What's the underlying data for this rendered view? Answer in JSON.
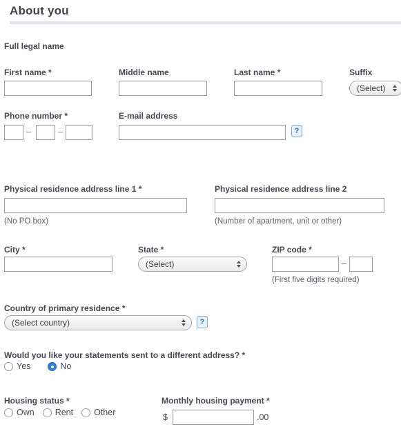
{
  "header": {
    "title": "About you"
  },
  "sections": {
    "full_legal_name": {
      "group_label": "Full legal name",
      "first_name": {
        "label": "First name *",
        "value": "",
        "placeholder": ""
      },
      "middle_name": {
        "label": "Middle name",
        "value": "",
        "placeholder": ""
      },
      "last_name": {
        "label": "Last name *",
        "value": "",
        "placeholder": ""
      },
      "suffix": {
        "label": "Suffix",
        "value": "(Select)"
      }
    },
    "contact": {
      "phone": {
        "label": "Phone number *",
        "part1": "",
        "part2": "",
        "part3": "",
        "separator": "–"
      },
      "email": {
        "label": "E-mail address",
        "value": "",
        "help_glyph": "?"
      }
    },
    "address": {
      "line1": {
        "label": "Physical residence address line 1 *",
        "value": "",
        "hint": "(No PO box)"
      },
      "line2": {
        "label": "Physical residence address line 2",
        "value": "",
        "hint": "(Number of apartment, unit or other)"
      },
      "city": {
        "label": "City *",
        "value": ""
      },
      "state": {
        "label": "State *",
        "value": "(Select)"
      },
      "zip": {
        "label": "ZIP code *",
        "value1": "",
        "value2": "",
        "separator": "–",
        "hint": "(First five digits required)"
      }
    },
    "country": {
      "label": "Country of primary residence *",
      "value": "(Select country)",
      "help_glyph": "?"
    },
    "statements": {
      "question": "Would you like your statements sent to a different address? *",
      "options": [
        {
          "label": "Yes",
          "selected": false
        },
        {
          "label": "No",
          "selected": true
        }
      ]
    },
    "housing": {
      "status": {
        "label": "Housing status *",
        "options": [
          {
            "label": "Own",
            "selected": false
          },
          {
            "label": "Rent",
            "selected": false
          },
          {
            "label": "Other",
            "selected": false
          }
        ]
      },
      "payment": {
        "label": "Monthly housing payment *",
        "currency_symbol": "$",
        "value": "",
        "cents_suffix": ".00"
      }
    }
  },
  "colors": {
    "accent": "#2b7fd4",
    "label_text": "#44484f",
    "rule": "#dfe3ec",
    "input_border": "#9a9a9a",
    "help_border": "#7aa9d6",
    "help_bg": "#e9f1fa"
  }
}
